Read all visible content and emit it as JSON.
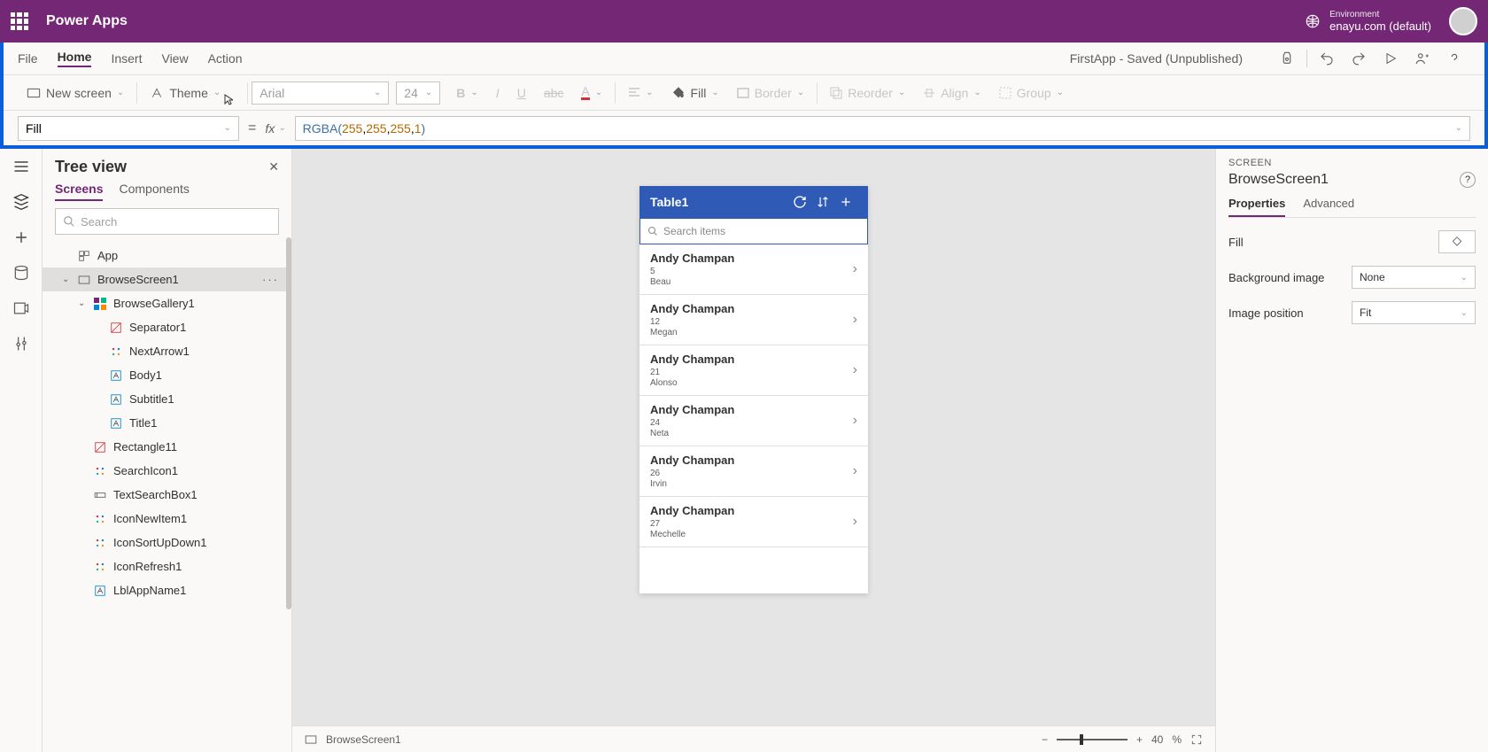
{
  "header": {
    "product": "Power Apps",
    "env_label": "Environment",
    "env_value": "enayu.com (default)"
  },
  "menu": {
    "items": [
      "File",
      "Home",
      "Insert",
      "View",
      "Action"
    ],
    "active": "Home",
    "status": "FirstApp - Saved (Unpublished)"
  },
  "toolbar": {
    "new_screen": "New screen",
    "theme": "Theme",
    "font": "Arial",
    "size": "24",
    "fill": "Fill",
    "border": "Border",
    "reorder": "Reorder",
    "align": "Align",
    "group": "Group"
  },
  "formula": {
    "property": "Fill",
    "fx": "fx",
    "tokens": {
      "fn": "RGBA",
      "open": "(",
      "a": "255",
      "c1": ", ",
      "b": "255",
      "c2": ", ",
      "c": "255",
      "c3": ", ",
      "d": "1",
      "close": ")"
    }
  },
  "tree": {
    "title": "Tree view",
    "tabs": {
      "screens": "Screens",
      "components": "Components"
    },
    "search_placeholder": "Search",
    "items": [
      {
        "label": "App",
        "indent": 0,
        "icon": "app",
        "expand": ""
      },
      {
        "label": "BrowseScreen1",
        "indent": 0,
        "icon": "screen",
        "expand": "⌄",
        "selected": true,
        "more": true
      },
      {
        "label": "BrowseGallery1",
        "indent": 1,
        "icon": "gallery",
        "expand": "⌄"
      },
      {
        "label": "Separator1",
        "indent": 2,
        "icon": "sep"
      },
      {
        "label": "NextArrow1",
        "indent": 2,
        "icon": "ctl"
      },
      {
        "label": "Body1",
        "indent": 2,
        "icon": "label"
      },
      {
        "label": "Subtitle1",
        "indent": 2,
        "icon": "label"
      },
      {
        "label": "Title1",
        "indent": 2,
        "icon": "label"
      },
      {
        "label": "Rectangle11",
        "indent": 1,
        "icon": "sep"
      },
      {
        "label": "SearchIcon1",
        "indent": 1,
        "icon": "ctl"
      },
      {
        "label": "TextSearchBox1",
        "indent": 1,
        "icon": "input"
      },
      {
        "label": "IconNewItem1",
        "indent": 1,
        "icon": "ctl"
      },
      {
        "label": "IconSortUpDown1",
        "indent": 1,
        "icon": "ctl"
      },
      {
        "label": "IconRefresh1",
        "indent": 1,
        "icon": "ctl"
      },
      {
        "label": "LblAppName1",
        "indent": 1,
        "icon": "label"
      }
    ]
  },
  "canvas": {
    "app_title": "Table1",
    "search_placeholder": "Search items",
    "gallery": [
      {
        "title": "Andy Champan",
        "sub1": "5",
        "sub2": "Beau"
      },
      {
        "title": "Andy Champan",
        "sub1": "12",
        "sub2": "Megan"
      },
      {
        "title": "Andy Champan",
        "sub1": "21",
        "sub2": "Alonso"
      },
      {
        "title": "Andy Champan",
        "sub1": "24",
        "sub2": "Neta"
      },
      {
        "title": "Andy Champan",
        "sub1": "26",
        "sub2": "Irvin"
      },
      {
        "title": "Andy Champan",
        "sub1": "27",
        "sub2": "Mechelle"
      }
    ],
    "footer": {
      "breadcrumb": "BrowseScreen1",
      "zoom": "40",
      "pct": "%"
    }
  },
  "props": {
    "label": "SCREEN",
    "name": "BrowseScreen1",
    "tabs": {
      "properties": "Properties",
      "advanced": "Advanced"
    },
    "rows": {
      "fill": "Fill",
      "bg_image": "Background image",
      "bg_image_val": "None",
      "img_pos": "Image position",
      "img_pos_val": "Fit"
    }
  }
}
